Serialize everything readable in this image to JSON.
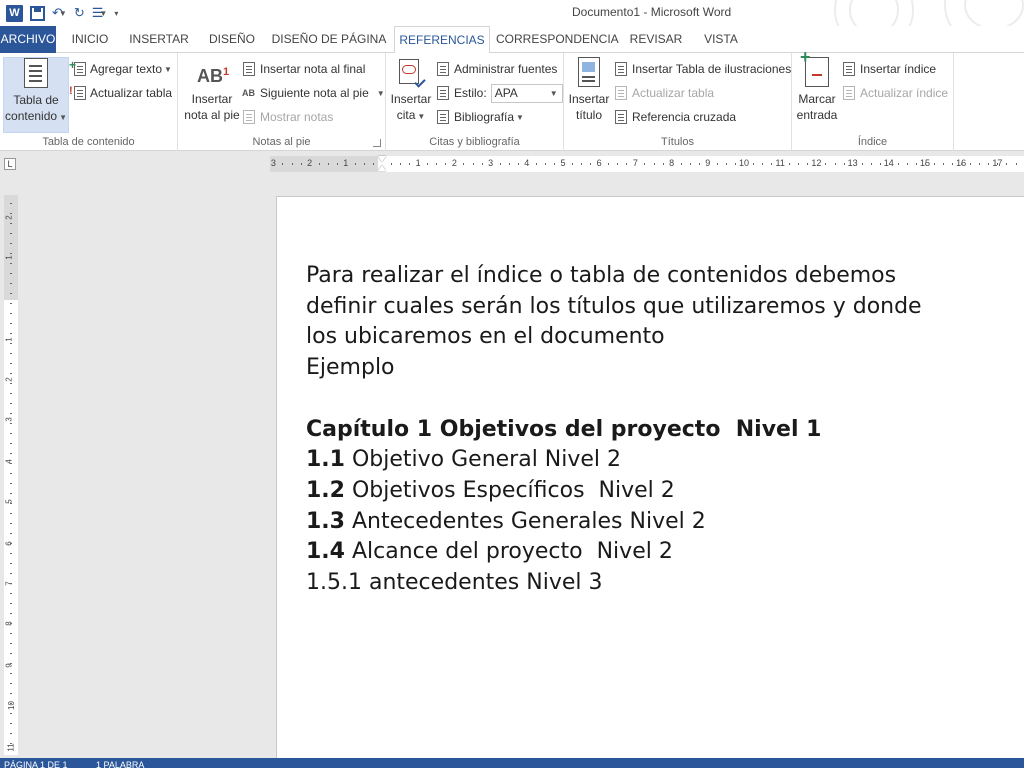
{
  "window": {
    "title": "Documento1 - Microsoft Word"
  },
  "qat": {
    "app_icon": "word-icon",
    "save_icon": "save-icon",
    "undo_icon": "undo-icon",
    "redo_icon": "redo-icon",
    "list_icon": "bullets-icon",
    "customize_icon": "customize-qat-icon"
  },
  "tabs": [
    {
      "label": "ARCHIVO"
    },
    {
      "label": "INICIO"
    },
    {
      "label": "INSERTAR"
    },
    {
      "label": "DISEÑO"
    },
    {
      "label": "DISEÑO DE PÁGINA"
    },
    {
      "label": "REFERENCIAS"
    },
    {
      "label": "CORRESPONDENCIA"
    },
    {
      "label": "REVISAR"
    },
    {
      "label": "VISTA"
    }
  ],
  "ribbon": {
    "toc_group": {
      "label": "Tabla de contenido",
      "toc_button": {
        "line1": "Tabla de",
        "line2": "contenido"
      },
      "add_text": "Agregar texto",
      "update_table": "Actualizar tabla"
    },
    "footnotes_group": {
      "label": "Notas al pie",
      "insert_footnote": {
        "line1": "Insertar",
        "line2": "nota al pie",
        "icon_text": "AB",
        "icon_sup": "1"
      },
      "insert_endnote": "Insertar nota al final",
      "next_footnote": "Siguiente nota al pie",
      "show_notes": "Mostrar notas"
    },
    "citations_group": {
      "label": "Citas y bibliografía",
      "insert_citation": {
        "line1": "Insertar",
        "line2": "cita"
      },
      "manage_sources": "Administrar fuentes",
      "style_label": "Estilo:",
      "style_value": "APA",
      "bibliography": "Bibliografía"
    },
    "captions_group": {
      "label": "Títulos",
      "insert_caption": {
        "line1": "Insertar",
        "line2": "título"
      },
      "insert_table_of_figures": "Insertar Tabla de ilustraciones",
      "update_table": "Actualizar tabla",
      "cross_reference": "Referencia cruzada"
    },
    "index_group": {
      "label": "Índice",
      "mark_entry": {
        "line1": "Marcar",
        "line2": "entrada"
      },
      "insert_index": "Insertar índice",
      "update_index": "Actualizar índice"
    }
  },
  "ruler": {
    "left_labels": [
      "3",
      "2",
      "1"
    ],
    "right_labels": [
      "1",
      "2",
      "3",
      "4",
      "5",
      "6",
      "7",
      "8",
      "9",
      "10",
      "11",
      "12",
      "13",
      "14",
      "15",
      "16",
      "17"
    ],
    "vertical_labels": [
      "2",
      "1",
      "1",
      "2",
      "3",
      "4",
      "5",
      "6",
      "7",
      "8",
      "9",
      "10",
      "11"
    ],
    "corner_symbol": "L"
  },
  "document": {
    "intro_lines": [
      "Para realizar el índice o tabla de contenidos debemos",
      "definir cuales serán los títulos que utilizaremos y donde",
      "los ubicaremos en el documento",
      "Ejemplo"
    ],
    "chapter": "Capítulo 1 Objetivos del proyecto  Nivel 1",
    "items": [
      {
        "num": "1.1",
        "text": " Objetivo General Nivel 2"
      },
      {
        "num": "1.2",
        "text": " Objetivos Específicos  Nivel 2"
      },
      {
        "num": "1.3",
        "text": " Antecedentes Generales Nivel 2"
      },
      {
        "num": "1.4",
        "text": " Alcance del proyecto  Nivel 2"
      }
    ],
    "subitem": "1.5.1 antecedentes Nivel 3"
  },
  "status": {
    "page": "PÁGINA 1 DE 1",
    "words": "1 PALABRA"
  },
  "colors": {
    "accent": "#2b579a",
    "ribbon_bg": "#ffffff",
    "workspace": "#e8e8e8"
  }
}
